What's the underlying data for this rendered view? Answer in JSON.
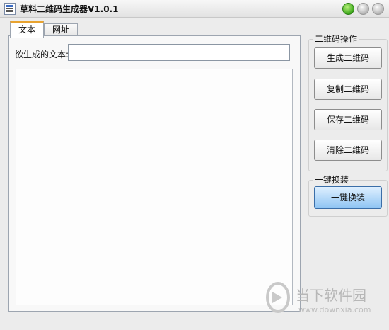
{
  "window": {
    "title": "草料二维码生成器V1.0.1"
  },
  "tabs": [
    {
      "label": "文本"
    },
    {
      "label": "网址"
    }
  ],
  "text_tab": {
    "field_label": "欲生成的文本:",
    "input_value": "",
    "content_value": ""
  },
  "qr_group": {
    "title": "二维码操作",
    "buttons": [
      {
        "label": "生成二维码"
      },
      {
        "label": "复制二维码"
      },
      {
        "label": "保存二维码"
      },
      {
        "label": "清除二维码"
      }
    ]
  },
  "skin_group": {
    "title": "一键换装",
    "button_label": "一键换装"
  },
  "watermark": {
    "text": "当下软件园",
    "url": "www.downxia.com"
  },
  "icons": [
    "app-icon",
    "minimize-icon",
    "maximize-icon",
    "close-icon",
    "watermark-logo-icon"
  ],
  "colors": {
    "active_tab_accent": "#e8a330",
    "skin_button": "#8ec4f3",
    "title_green_button": "#3da81c"
  }
}
